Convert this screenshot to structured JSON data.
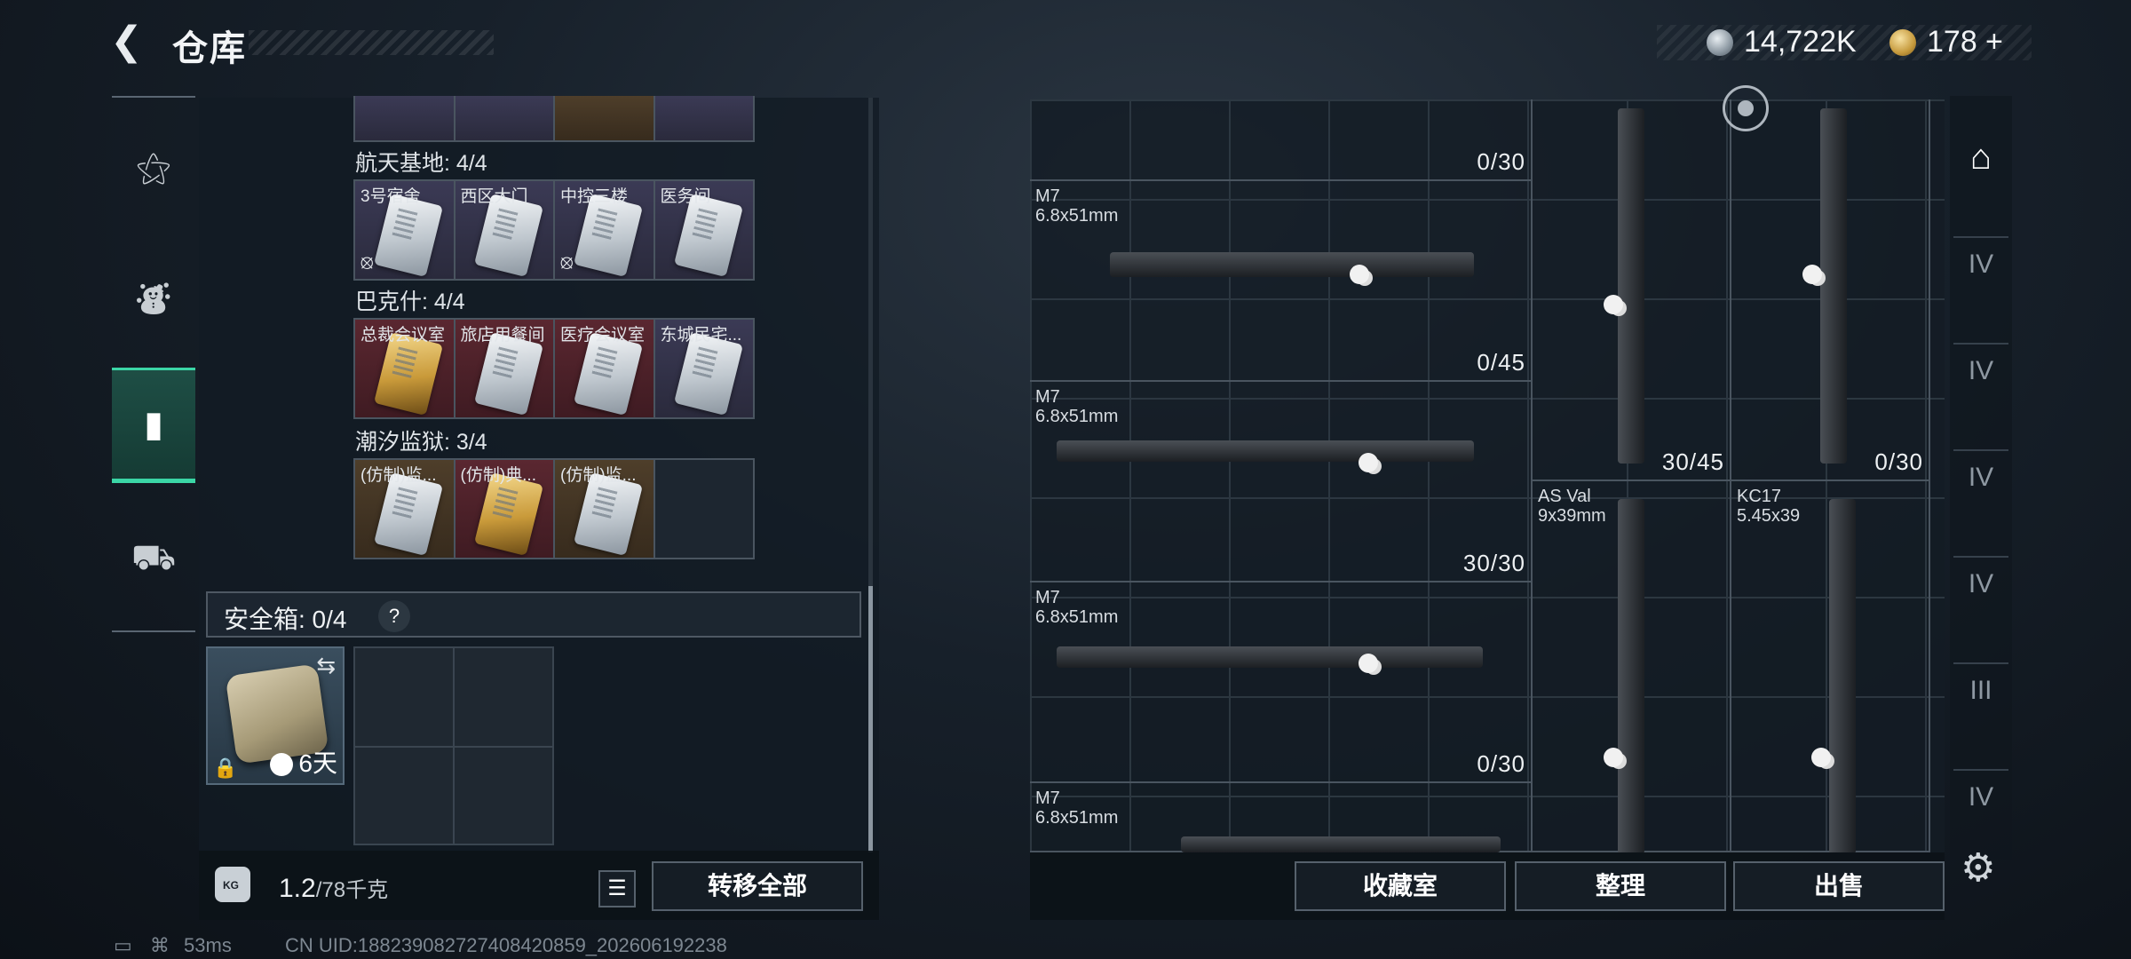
{
  "header": {
    "back_icon": "back-chevron-icon",
    "title": "仓库"
  },
  "currency": {
    "silver": "14,722K",
    "gold": "178",
    "gold_plus": "+"
  },
  "leftnav": [
    {
      "name": "weapons",
      "icon": "pistol-icon",
      "active": false
    },
    {
      "name": "gear",
      "icon": "armor-vest-icon",
      "active": false
    },
    {
      "name": "keys",
      "icon": "key-case-icon",
      "active": true
    },
    {
      "name": "supplies",
      "icon": "briefcase-icon",
      "active": false
    }
  ],
  "groups": [
    {
      "label": "航天基地: 4/4",
      "items": [
        "3号宿舍",
        "西区大门",
        "中控三楼",
        "医务间"
      ]
    },
    {
      "label": "巴克什: 4/4",
      "items": [
        "总裁会议室",
        "旅店用餐间",
        "医疗会议室",
        "东城民宅..."
      ]
    },
    {
      "label": "潮汐监狱: 3/4",
      "items": [
        "(仿制)监...",
        "(仿制)典...",
        "(仿制)监...",
        ""
      ]
    }
  ],
  "safe": {
    "label": "安全箱: 0/4",
    "help": "?",
    "days": "6天"
  },
  "footer": {
    "weight_current": "1.2",
    "weight_max": "/78千克",
    "transfer_all": "转移全部"
  },
  "status": {
    "ping": "53ms",
    "uid": "CN UID:188239082727408420859_202606192238"
  },
  "weapons": [
    {
      "name": "",
      "caliber": "",
      "ammo": "0/30"
    },
    {
      "name": "M7",
      "caliber": "6.8x51mm",
      "ammo": "0/45"
    },
    {
      "name": "M7",
      "caliber": "6.8x51mm",
      "ammo": "30/30"
    },
    {
      "name": "M7",
      "caliber": "6.8x51mm",
      "ammo": "0/30"
    },
    {
      "name": "M7",
      "caliber": "6.8x51mm",
      "ammo": ""
    },
    {
      "name": "",
      "caliber": "",
      "ammo": "30/45"
    },
    {
      "name": "",
      "caliber": "",
      "ammo": "0/30"
    },
    {
      "name": "AS Val",
      "caliber": "9x39mm",
      "ammo": ""
    },
    {
      "name": "KC17",
      "caliber": "5.45x39",
      "ammo": ""
    }
  ],
  "actions": {
    "collection": "收藏室",
    "organize": "整理",
    "sell": "出售"
  },
  "rside": [
    "IV",
    "IV",
    "IV",
    "IV",
    "III",
    "IV"
  ]
}
